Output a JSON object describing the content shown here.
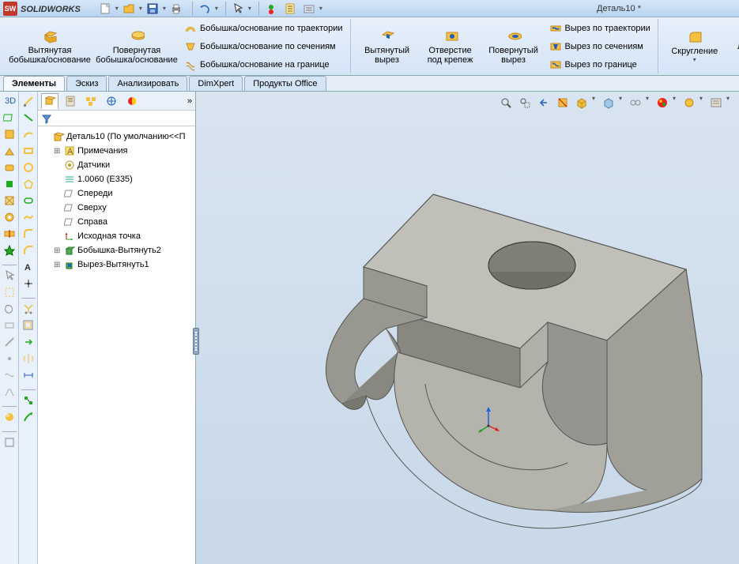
{
  "app": {
    "brand_a": "SOLID",
    "brand_b": "WORKS",
    "doc_title": "Деталь10 *"
  },
  "qat": {
    "new": "new",
    "open": "open",
    "save": "save",
    "print": "print",
    "undo": "undo",
    "select": "select",
    "rebuild": "rebuild",
    "file_props": "file-properties",
    "options": "options"
  },
  "ribbon": {
    "extrude_boss": "Вытянутая бобышка/основание",
    "revolve_boss": "Повернутая бобышка/основание",
    "sweep_boss": "Бобышка/основание по траектории",
    "loft_boss": "Бобышка/основание по сечениям",
    "boundary_boss": "Бобышка/основание на границе",
    "extrude_cut": "Вытянутый вырез",
    "hole_wizard": "Отверстие под крепеж",
    "revolve_cut": "Повернутый вырез",
    "sweep_cut": "Вырез по траектории",
    "loft_cut": "Вырез по сечениям",
    "boundary_cut": "Вырез по границе",
    "fillet": "Скругление",
    "linear_pattern": "Линейный массив"
  },
  "tabs": {
    "features": "Элементы",
    "sketch": "Эскиз",
    "evaluate": "Анализировать",
    "dimxpert": "DimXpert",
    "office": "Продукты Office"
  },
  "tree": {
    "root": "Деталь10  (По умолчанию<<П",
    "annotations": "Примечания",
    "sensors": "Датчики",
    "material": "1.0060 (E335)",
    "front": "Спереди",
    "top": "Сверху",
    "right": "Справа",
    "origin": "Исходная точка",
    "feat1": "Бобышка-Вытянуть2",
    "feat2": "Вырез-Вытянуть1"
  },
  "filter_placeholder": ""
}
